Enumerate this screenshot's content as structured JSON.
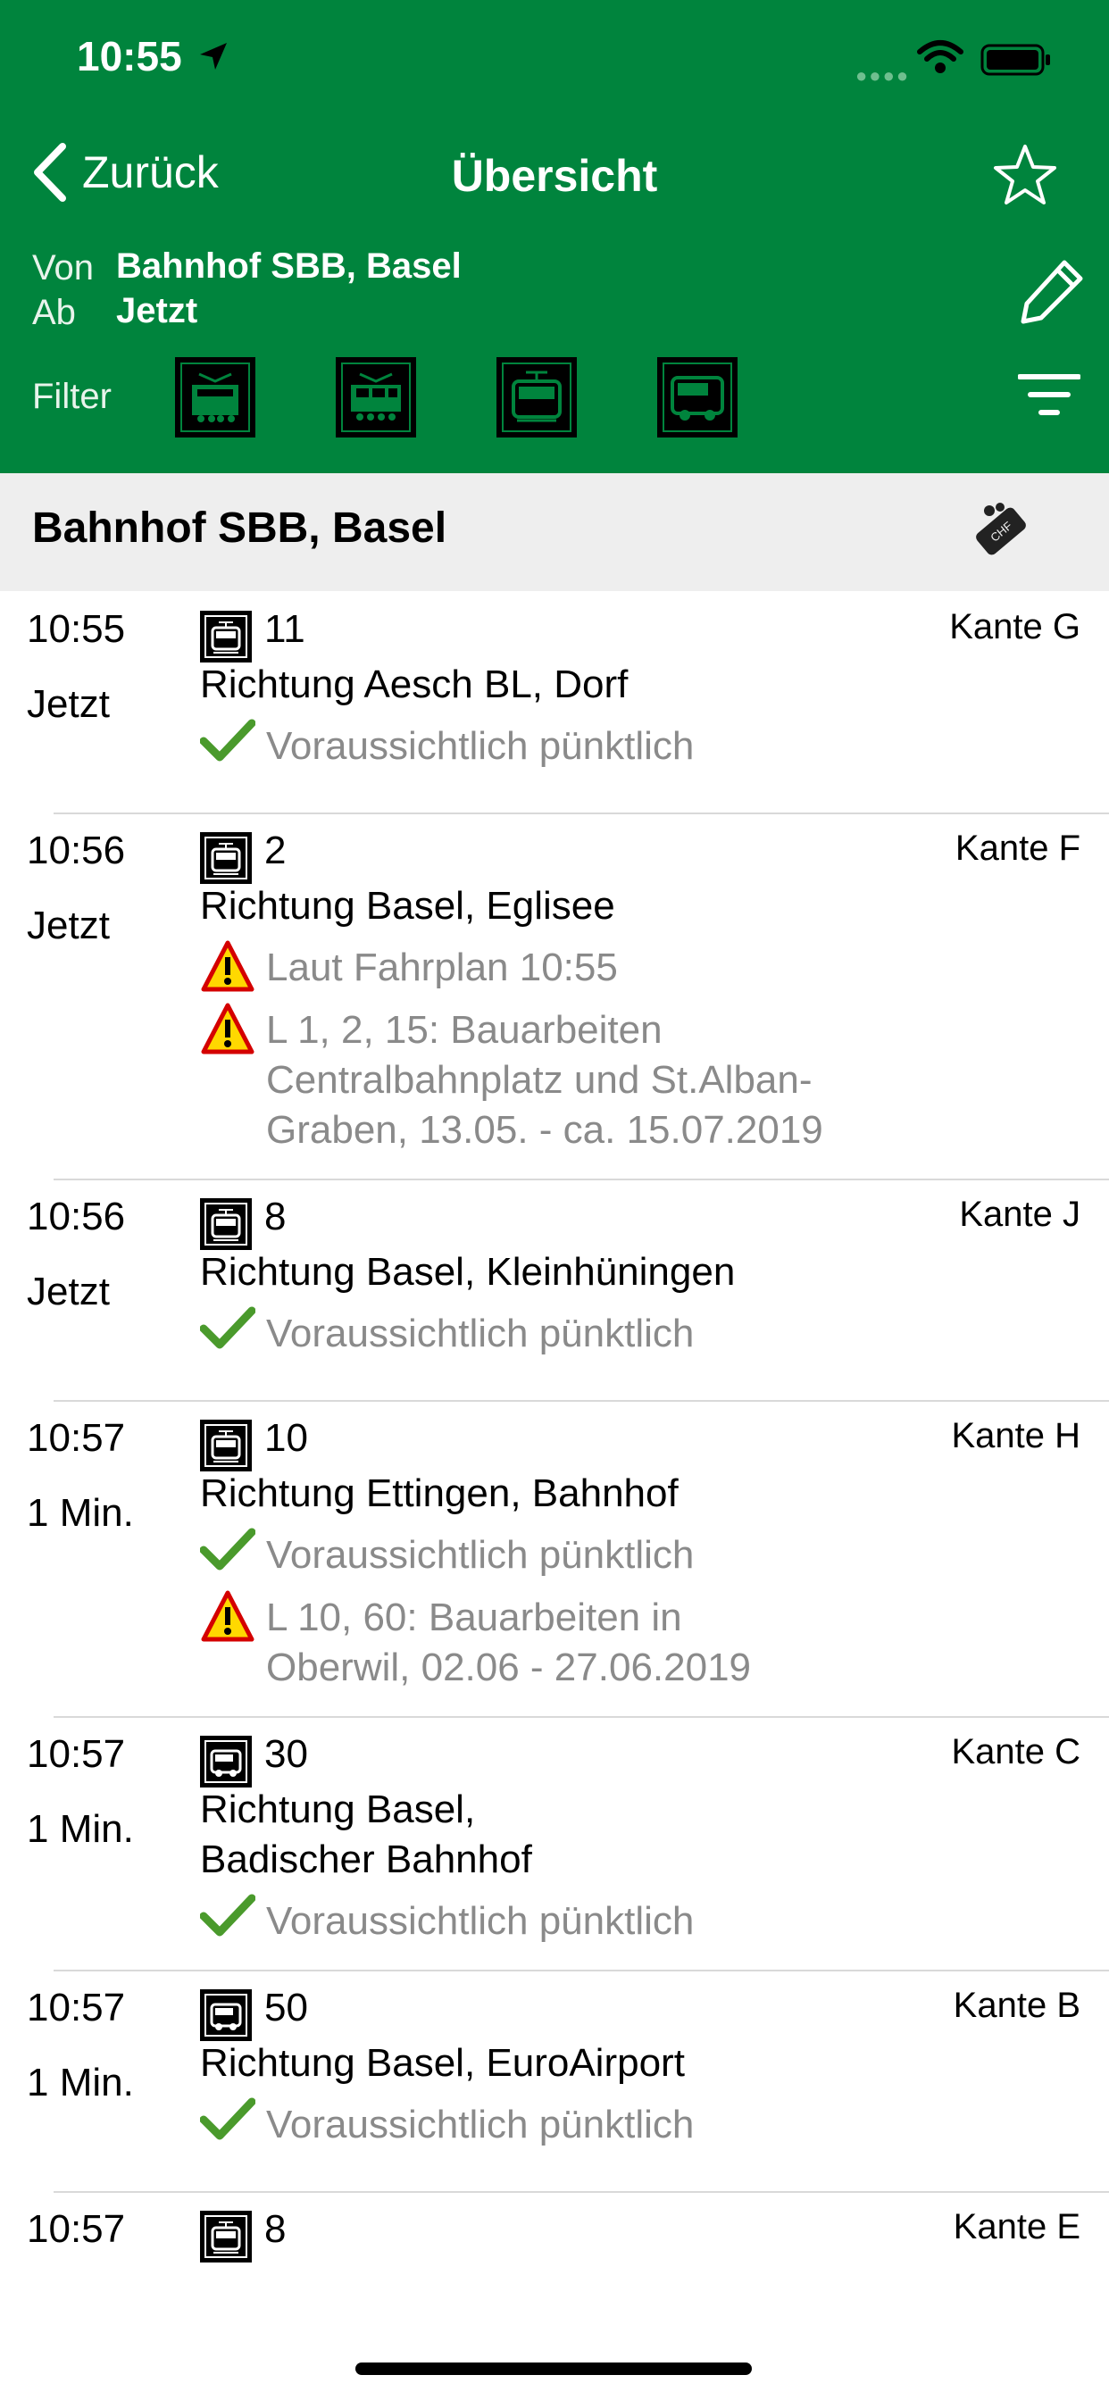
{
  "status": {
    "time": "10:55"
  },
  "nav": {
    "back_label": "Zurück",
    "title": "Übersicht"
  },
  "query": {
    "from_label": "Von",
    "from_value": "Bahnhof SBB, Basel",
    "time_label": "Ab",
    "time_value": "Jetzt",
    "filter_label": "Filter",
    "filters": [
      "train-icon",
      "regional-train-icon",
      "tram-icon",
      "bus-icon"
    ]
  },
  "station": {
    "name": "Bahnhof SBB, Basel"
  },
  "departures": [
    {
      "time": "10:55",
      "when": "Jetzt",
      "vehicle": "tram-icon",
      "line": "11",
      "platform": "Kante G",
      "direction": [
        "Richtung Aesch BL, Dorf"
      ],
      "messages": [
        {
          "type": "ok",
          "lines": [
            "Voraussichtlich pünktlich"
          ]
        }
      ]
    },
    {
      "time": "10:56",
      "when": "Jetzt",
      "vehicle": "tram-icon",
      "line": "2",
      "platform": "Kante F",
      "direction": [
        "Richtung Basel, Eglisee"
      ],
      "messages": [
        {
          "type": "warn",
          "lines": [
            "Laut Fahrplan 10:55"
          ]
        },
        {
          "type": "warn",
          "lines": [
            "L 1, 2, 15: Bauarbeiten",
            "Centralbahnplatz und St.Alban-",
            "Graben, 13.05. - ca. 15.07.2019"
          ]
        }
      ]
    },
    {
      "time": "10:56",
      "when": "Jetzt",
      "vehicle": "tram-icon",
      "line": "8",
      "platform": "Kante J",
      "direction": [
        "Richtung Basel, Kleinhüningen"
      ],
      "messages": [
        {
          "type": "ok",
          "lines": [
            "Voraussichtlich pünktlich"
          ]
        }
      ]
    },
    {
      "time": "10:57",
      "when": "1 Min.",
      "vehicle": "tram-icon",
      "line": "10",
      "platform": "Kante H",
      "direction": [
        "Richtung Ettingen, Bahnhof"
      ],
      "messages": [
        {
          "type": "ok",
          "lines": [
            "Voraussichtlich pünktlich"
          ]
        },
        {
          "type": "warn",
          "lines": [
            "L 10, 60: Bauarbeiten in",
            "Oberwil, 02.06 - 27.06.2019"
          ]
        }
      ]
    },
    {
      "time": "10:57",
      "when": "1 Min.",
      "vehicle": "bus-icon",
      "line": "30",
      "platform": "Kante C",
      "direction": [
        "Richtung Basel,",
        "Badischer Bahnhof"
      ],
      "messages": [
        {
          "type": "ok",
          "lines": [
            "Voraussichtlich pünktlich"
          ]
        }
      ]
    },
    {
      "time": "10:57",
      "when": "1 Min.",
      "vehicle": "bus-icon",
      "line": "50",
      "platform": "Kante B",
      "direction": [
        "Richtung Basel, EuroAirport"
      ],
      "messages": [
        {
          "type": "ok",
          "lines": [
            "Voraussichtlich pünktlich"
          ]
        }
      ]
    },
    {
      "time": "10:57",
      "when": "",
      "vehicle": "tram-icon",
      "line": "8",
      "platform": "Kante E",
      "direction": [],
      "messages": []
    }
  ],
  "colors": {
    "header": "#00843d",
    "ok": "#4a9a2c",
    "warn_fill": "#ffd800",
    "warn_border": "#d40000"
  }
}
